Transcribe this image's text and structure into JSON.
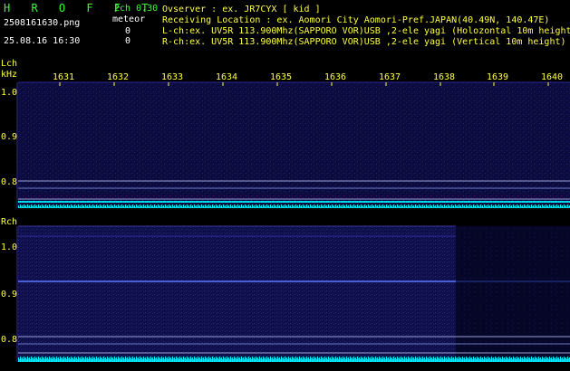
{
  "header": {
    "logo_text": "H R O F F T",
    "filename": "2508161630.png",
    "timestamp": "25.08.16 16:30",
    "version": "2ch 0.30",
    "meteor_label": "meteor",
    "lch_count": "0",
    "rch_count": "0",
    "observer": "Ovserver            : ex. JR7CYX [ kid ]",
    "location": "Receiving Location : ex. Aomori City Aomori-Pref.JAPAN(40.49N, 140.47E)",
    "lch_desc": "L-ch:ex. UV5R 113.900Mhz(SAPPORO VOR)USB ,2-ele yagi (Holozontal 10m height)",
    "rch_desc": "R-ch:ex. UV5R 113.900Mhz(SAPPORO VOR)USB ,2-ele yagi (Vertical 10m height)"
  },
  "lch_panel": {
    "channel_label": "Lch",
    "unit_label": "kHz",
    "y_ticks": [
      "1.0",
      "0.9",
      "0.8"
    ]
  },
  "rch_panel": {
    "channel_label": "Rch",
    "y_ticks": [
      "1.0",
      "0.9",
      "0.8"
    ]
  },
  "time_axis": {
    "labels": [
      "1631",
      "1632",
      "1633",
      "1634",
      "1635",
      "1636",
      "1637",
      "1638",
      "1639",
      "1640"
    ]
  },
  "colors": {
    "background": "#000000",
    "spectrogram_bg": "#0a0a3c",
    "noise_floor": "#00ffff",
    "text_green": "#38ff38",
    "text_yellow": "#ffff40"
  }
}
